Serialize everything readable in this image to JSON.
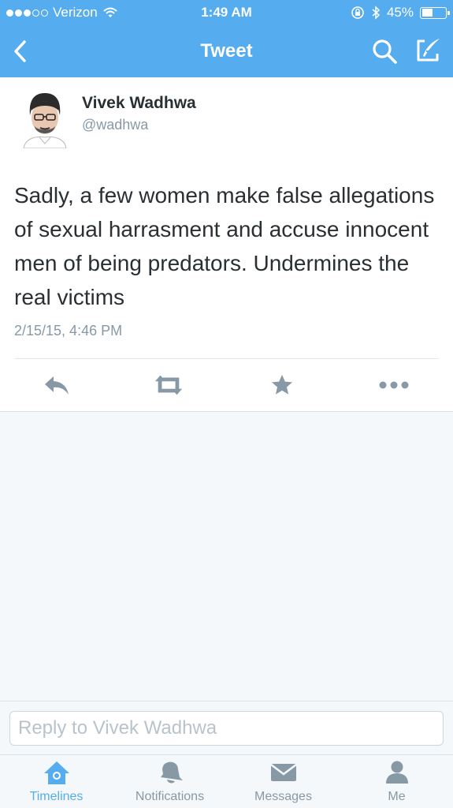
{
  "status_bar": {
    "carrier": "Verizon",
    "signal_bars_filled": 3,
    "signal_bars_total": 5,
    "time": "1:49 AM",
    "battery": "45%",
    "battery_level": 0.45
  },
  "nav": {
    "title": "Tweet",
    "icons": [
      "back-chevron-icon",
      "search-icon",
      "compose-icon"
    ]
  },
  "tweet": {
    "author_name": "Vivek Wadhwa",
    "author_handle": "@wadhwa",
    "text": "Sadly, a few women make false allegations of sexual harrasment and accuse innocent men of being predators. Undermines the real victims",
    "timestamp": "2/15/15, 4:46 PM",
    "actions": [
      "reply-icon",
      "retweet-icon",
      "favorite-icon",
      "more-icon"
    ]
  },
  "reply": {
    "placeholder": "Reply to Vivek Wadhwa"
  },
  "tabbar": {
    "tabs": [
      {
        "label": "Timelines",
        "icon": "home-icon",
        "active": true
      },
      {
        "label": "Notifications",
        "icon": "bell-icon",
        "active": false
      },
      {
        "label": "Messages",
        "icon": "envelope-icon",
        "active": false
      },
      {
        "label": "Me",
        "icon": "person-icon",
        "active": false
      }
    ]
  },
  "colors": {
    "brand": "#55acee",
    "text": "#292f33",
    "muted": "#8899a6",
    "background": "#f5f8fa"
  }
}
